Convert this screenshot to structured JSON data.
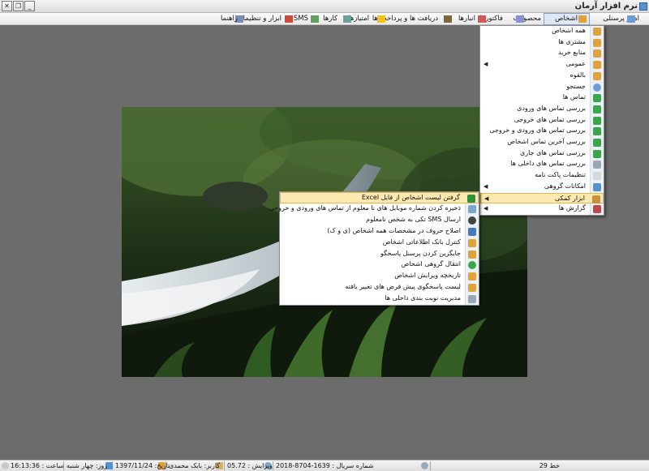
{
  "window": {
    "title": "نرم افزار آرمان"
  },
  "menubar": {
    "items": [
      {
        "label": "امور پرسنلی"
      },
      {
        "label": "اشخاص"
      },
      {
        "label": "محصولات"
      },
      {
        "label": "فاکتورها"
      },
      {
        "label": "انبارها"
      },
      {
        "label": "دریافت ها و پرداخت ها"
      },
      {
        "label": "امتیازها"
      },
      {
        "label": "کارها"
      },
      {
        "label": "SMS"
      },
      {
        "label": "ابزار و تنظیمات"
      },
      {
        "label": "راهنما"
      }
    ]
  },
  "persons_menu": {
    "items": [
      {
        "label": "همه اشخاص",
        "icon": "people-icon",
        "submenu": false
      },
      {
        "label": "مشتری ها",
        "icon": "people-icon",
        "submenu": false
      },
      {
        "label": "منابع خرید",
        "icon": "people-icon",
        "submenu": false
      },
      {
        "label": "عمومی",
        "icon": "people-icon",
        "submenu": true
      },
      {
        "label": "بالقوه",
        "icon": "people-icon",
        "submenu": false
      },
      {
        "label": "جستجو",
        "icon": "search-icon",
        "submenu": false
      },
      {
        "label": "تماس ها",
        "icon": "phone-icon",
        "submenu": false
      },
      {
        "label": "بررسی تماس های ورودی",
        "icon": "phone-icon",
        "submenu": false
      },
      {
        "label": "بررسی تماس های خروجی",
        "icon": "phone-icon",
        "submenu": false
      },
      {
        "label": "بررسی تماس های ورودی و خروجی",
        "icon": "phone-icon",
        "submenu": false
      },
      {
        "label": "بررسی آخرین تماس اشخاص",
        "icon": "phone-icon",
        "submenu": false
      },
      {
        "label": "بررسی تماس های جاری",
        "icon": "phone-icon",
        "submenu": false
      },
      {
        "label": "بررسی تماس های داخلی ها",
        "icon": "pen-icon",
        "submenu": false
      },
      {
        "label": "تنظیمات پاکت نامه",
        "icon": "envelope-icon",
        "submenu": false
      },
      {
        "label": "امکانات گروهی",
        "icon": "group-icon",
        "submenu": true
      },
      {
        "label": "ابزار کمکی",
        "icon": "wrench-icon",
        "submenu": true
      },
      {
        "label": "گزارش ها",
        "icon": "report-icon",
        "submenu": true
      }
    ]
  },
  "tools_submenu": {
    "items": [
      {
        "label": "گرفتن لیست اشخاص از فایل Excel",
        "icon": "excel-icon"
      },
      {
        "label": "ذخیره کردن شماره موبایل های نا معلوم از تماس های ورودی و خروجی",
        "icon": "save-phone-icon"
      },
      {
        "label": "ارسال SMS تکی به شخص نامعلوم",
        "icon": "sms-icon"
      },
      {
        "label": "اصلاح حروف در مشخصات همه اشخاص (ی و ک)",
        "icon": "abc-icon"
      },
      {
        "label": "کنترل بانک اطلاعاتی اشخاص",
        "icon": "people-icon"
      },
      {
        "label": "جایگزین کردن پرسنل پاسخگو",
        "icon": "people-icon"
      },
      {
        "label": "انتقال گروهی اشخاص",
        "icon": "add-green-icon"
      },
      {
        "label": "تاریخچه ویرایش اشخاص",
        "icon": "people-icon"
      },
      {
        "label": "لیست پاسخگوی پیش فرض های تغییر یافته",
        "icon": "people-icon"
      },
      {
        "label": "مدیریت نوبت بندی داخلی ها",
        "icon": "pen-icon"
      }
    ]
  },
  "statusbar": {
    "line": "خط 29",
    "serial": "شماره سریال : 1639-8704-2018",
    "version": "ویرایش : 05.72",
    "user": "کاربر: بابک محمدی",
    "date": "تاریخ: 1397/11/24",
    "day": "روز: چهار شنبه",
    "time": "ساعت : 16:13:36"
  },
  "colors": {
    "highlight": "#fce9b0",
    "desktop": "#6c6c6c",
    "menu_active": "#dfe6f4"
  }
}
